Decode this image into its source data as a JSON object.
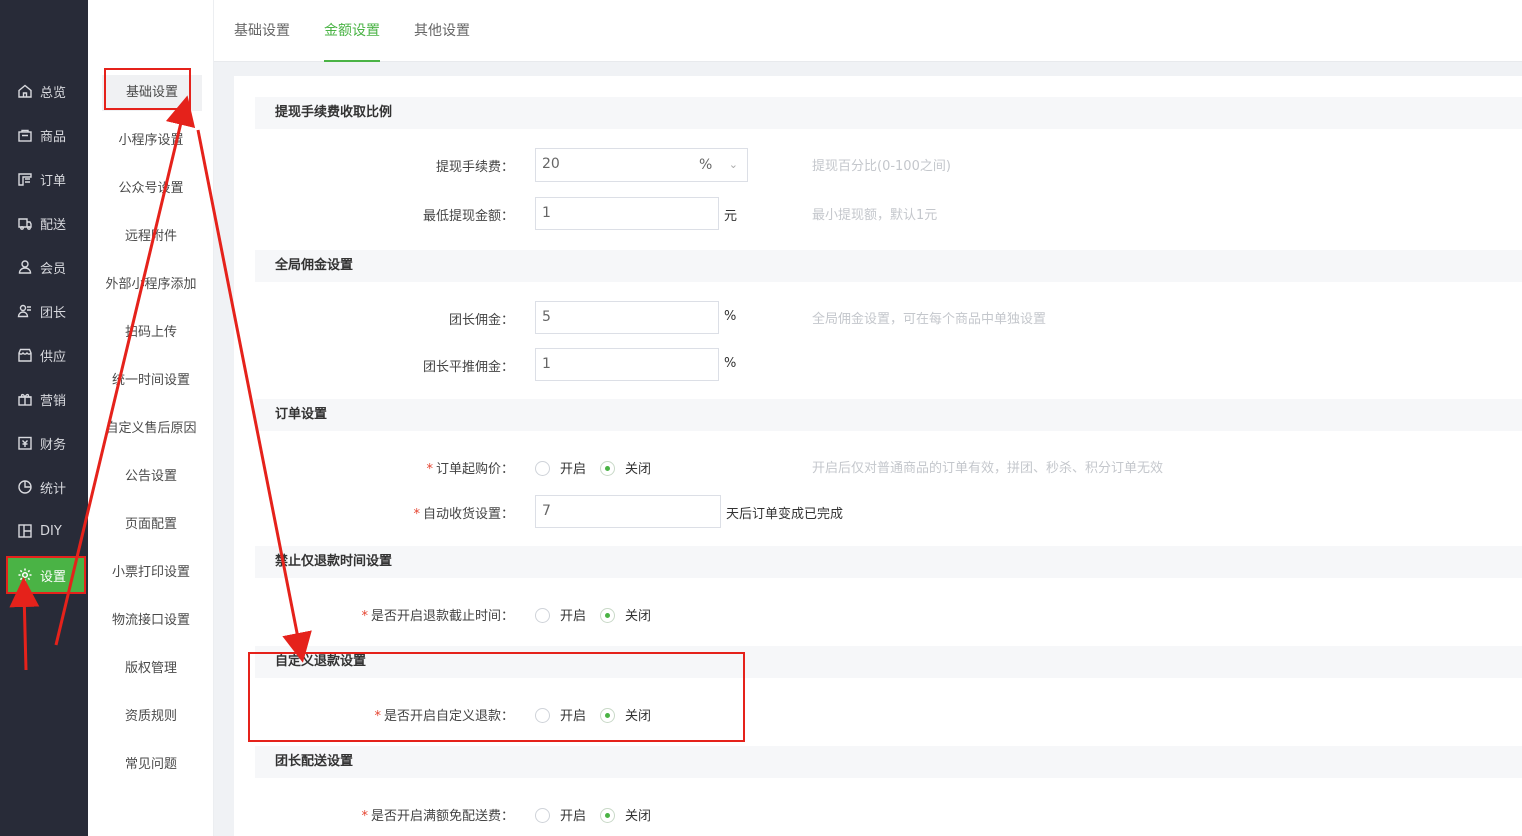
{
  "sidebar": {
    "items": [
      {
        "label": "总览",
        "icon": "home-icon"
      },
      {
        "label": "商品",
        "icon": "bag-icon"
      },
      {
        "label": "订单",
        "icon": "order-icon"
      },
      {
        "label": "配送",
        "icon": "truck-icon"
      },
      {
        "label": "会员",
        "icon": "user-icon"
      },
      {
        "label": "团长",
        "icon": "leader-icon"
      },
      {
        "label": "供应",
        "icon": "store-icon"
      },
      {
        "label": "营销",
        "icon": "gift-icon"
      },
      {
        "label": "财务",
        "icon": "finance-icon"
      },
      {
        "label": "统计",
        "icon": "pie-icon"
      },
      {
        "label": "DIY",
        "icon": "layout-icon"
      },
      {
        "label": "设置",
        "icon": "gear-icon"
      }
    ],
    "active": "设置"
  },
  "submenu": {
    "items": [
      "基础设置",
      "小程序设置",
      "公众号设置",
      "远程附件",
      "外部小程序添加",
      "扫码上传",
      "统一时间设置",
      "自定义售后原因",
      "公告设置",
      "页面配置",
      "小票打印设置",
      "物流接口设置",
      "版权管理",
      "资质规则",
      "常见问题"
    ],
    "active": "基础设置"
  },
  "tabs": {
    "items": [
      "基础设置",
      "金额设置",
      "其他设置"
    ],
    "active": "金额设置"
  },
  "sections": {
    "withdraw": {
      "title": "提现手续费收取比例",
      "fee_label": "提现手续费：",
      "fee_value": "20",
      "fee_unit_select": "%",
      "fee_hint": "提现百分比(0-100之间)",
      "min_label": "最低提现金额：",
      "min_value": "1",
      "min_unit": "元",
      "min_hint": "最小提现额，默认1元"
    },
    "commission": {
      "title": "全局佣金设置",
      "leader_label": "团长佣金：",
      "leader_value": "5",
      "leader_unit": "%",
      "leader_hint": "全局佣金设置，可在每个商品中单独设置",
      "push_label": "团长平推佣金：",
      "push_value": "1",
      "push_unit": "%"
    },
    "order": {
      "title": "订单设置",
      "min_buy_label": "订单起购价：",
      "min_buy_on": "开启",
      "min_buy_off": "关闭",
      "min_buy_hint": "开启后仅对普通商品的订单有效，拼团、秒杀、积分订单无效",
      "auto_label": "自动收货设置：",
      "auto_value": "7",
      "auto_unit": "天后订单变成已完成"
    },
    "refund_deadline": {
      "title": "禁止仅退款时间设置",
      "label": "是否开启退款截止时间：",
      "on": "开启",
      "off": "关闭"
    },
    "custom_refund": {
      "title": "自定义退款设置",
      "label": "是否开启自定义退款：",
      "on": "开启",
      "off": "关闭"
    },
    "delivery": {
      "title": "团长配送设置",
      "label": "是否开启满额免配送费：",
      "on": "开启",
      "off": "关闭"
    }
  },
  "colors": {
    "accent": "#4ab345",
    "annotation": "#e5221b",
    "sidebar_bg": "#282b38"
  }
}
